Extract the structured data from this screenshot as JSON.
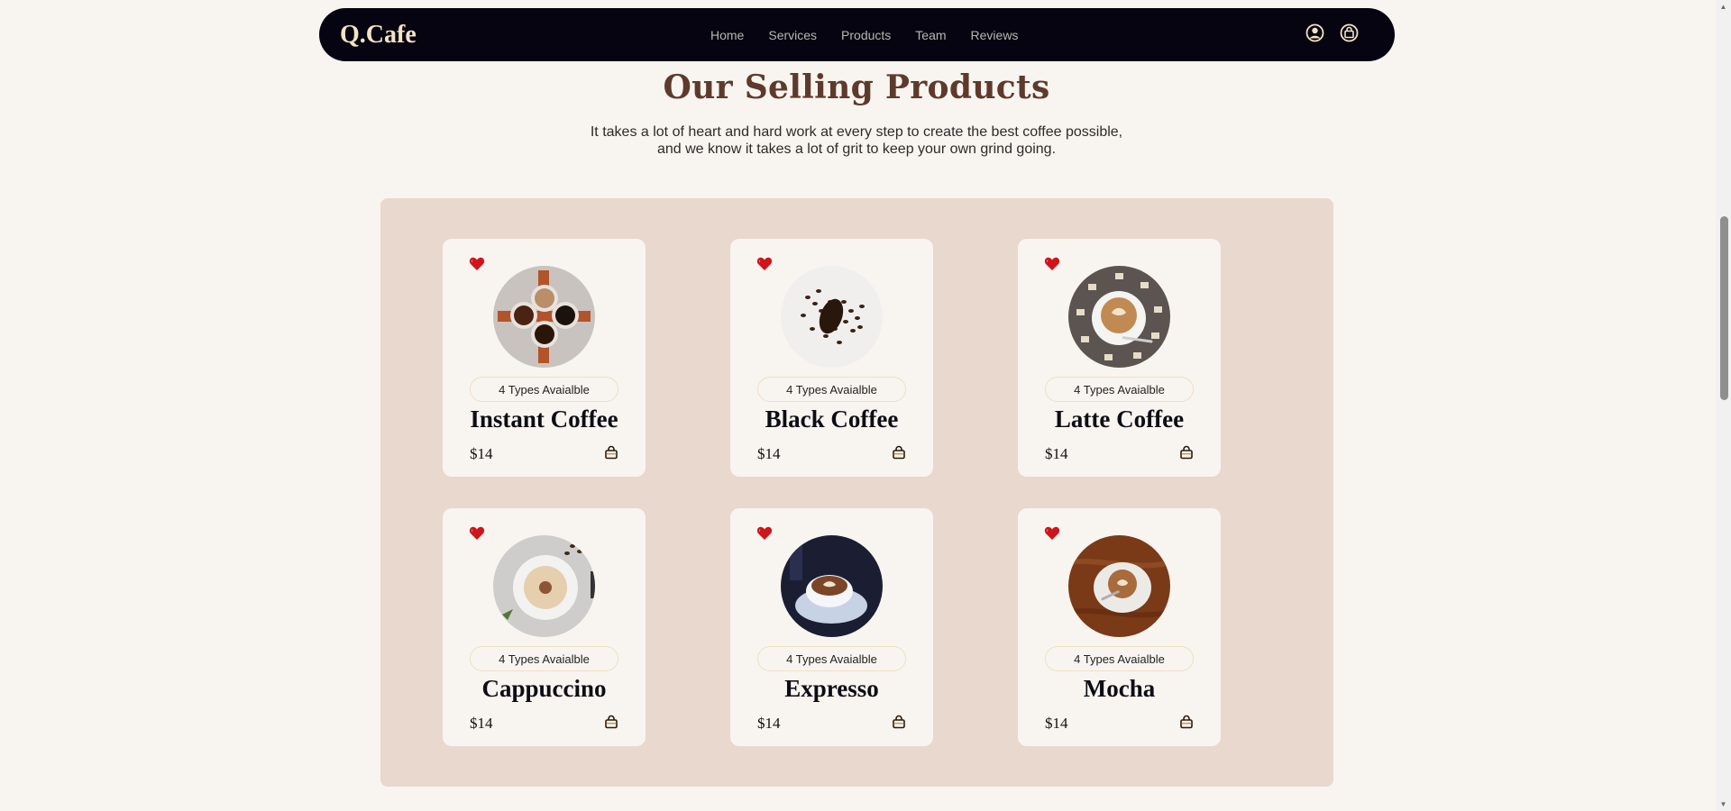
{
  "nav": {
    "logo": "Q.Cafe",
    "links": [
      "Home",
      "Services",
      "Products",
      "Team",
      "Reviews"
    ],
    "icons": [
      "user-icon",
      "shopping-bag-icon"
    ]
  },
  "section": {
    "title": "Our Selling Products",
    "description_line1": "It takes a lot of heart and hard work at every step to create the best coffee possible,",
    "description_line2": "and we know it takes a lot of grit to keep your own grind going."
  },
  "products": [
    {
      "name": "Instant Coffee",
      "types": "4 Types Avaialble",
      "price": "$14"
    },
    {
      "name": "Black Coffee",
      "types": "4 Types Avaialble",
      "price": "$14"
    },
    {
      "name": "Latte Coffee",
      "types": "4 Types Avaialble",
      "price": "$14"
    },
    {
      "name": "Cappuccino",
      "types": "4 Types Avaialble",
      "price": "$14"
    },
    {
      "name": "Expresso",
      "types": "4 Types Avaialble",
      "price": "$14"
    },
    {
      "name": "Mocha",
      "types": "4 Types Avaialble",
      "price": "$14"
    }
  ],
  "colors": {
    "background": "#f8f5f0",
    "navbar": "#050410",
    "logo": "#f4e3c3",
    "title": "#5e3a2c",
    "panel": "#e8d8ce",
    "heart": "#d0141b"
  }
}
